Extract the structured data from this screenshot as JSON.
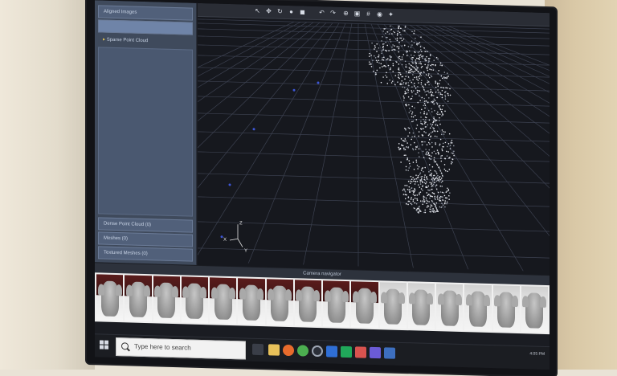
{
  "left_panel": {
    "top_rows": [
      "Aligned Images",
      "",
      "Sparse Point Cloud"
    ],
    "bottom_rows": [
      "Dense Point Cloud (0)",
      "Meshes (0)",
      "Textured Meshes (0)"
    ]
  },
  "viewport": {
    "axis_labels": {
      "z": "Z",
      "x": "X",
      "y": "Y"
    }
  },
  "camera_strip": {
    "title": "Camera navigator",
    "thumbnails": 16
  },
  "taskbar": {
    "search_placeholder": "Type here to search",
    "tray_text": "4:05 PM"
  }
}
